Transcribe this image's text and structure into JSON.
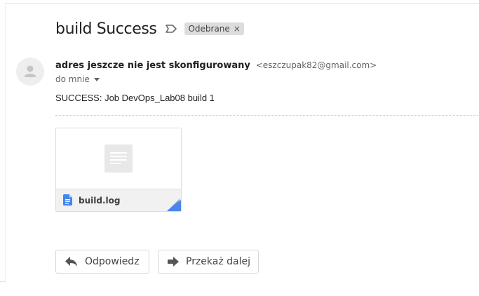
{
  "message": {
    "subject": "build Success",
    "label_chip": "Odebrane",
    "label_remove_symbol": "×",
    "sender_name": "adres jeszcze nie jest skonfigurowany",
    "sender_email": "<eszczupak82@gmail.com>",
    "recipient_text": "do mnie",
    "body": "SUCCESS: Job DevOps_Lab08 build 1"
  },
  "attachment": {
    "file_name": "build.log",
    "icon": "google-docs-icon",
    "accent_color": "#4285f4"
  },
  "actions": {
    "reply_label": "Odpowiedz",
    "forward_label": "Przekaż dalej"
  },
  "icons": {
    "label": "label-outline-icon",
    "avatar": "person-avatar-icon",
    "recipient_menu": "chevron-down-icon",
    "reply": "reply-arrow-icon",
    "forward": "forward-arrow-icon"
  }
}
